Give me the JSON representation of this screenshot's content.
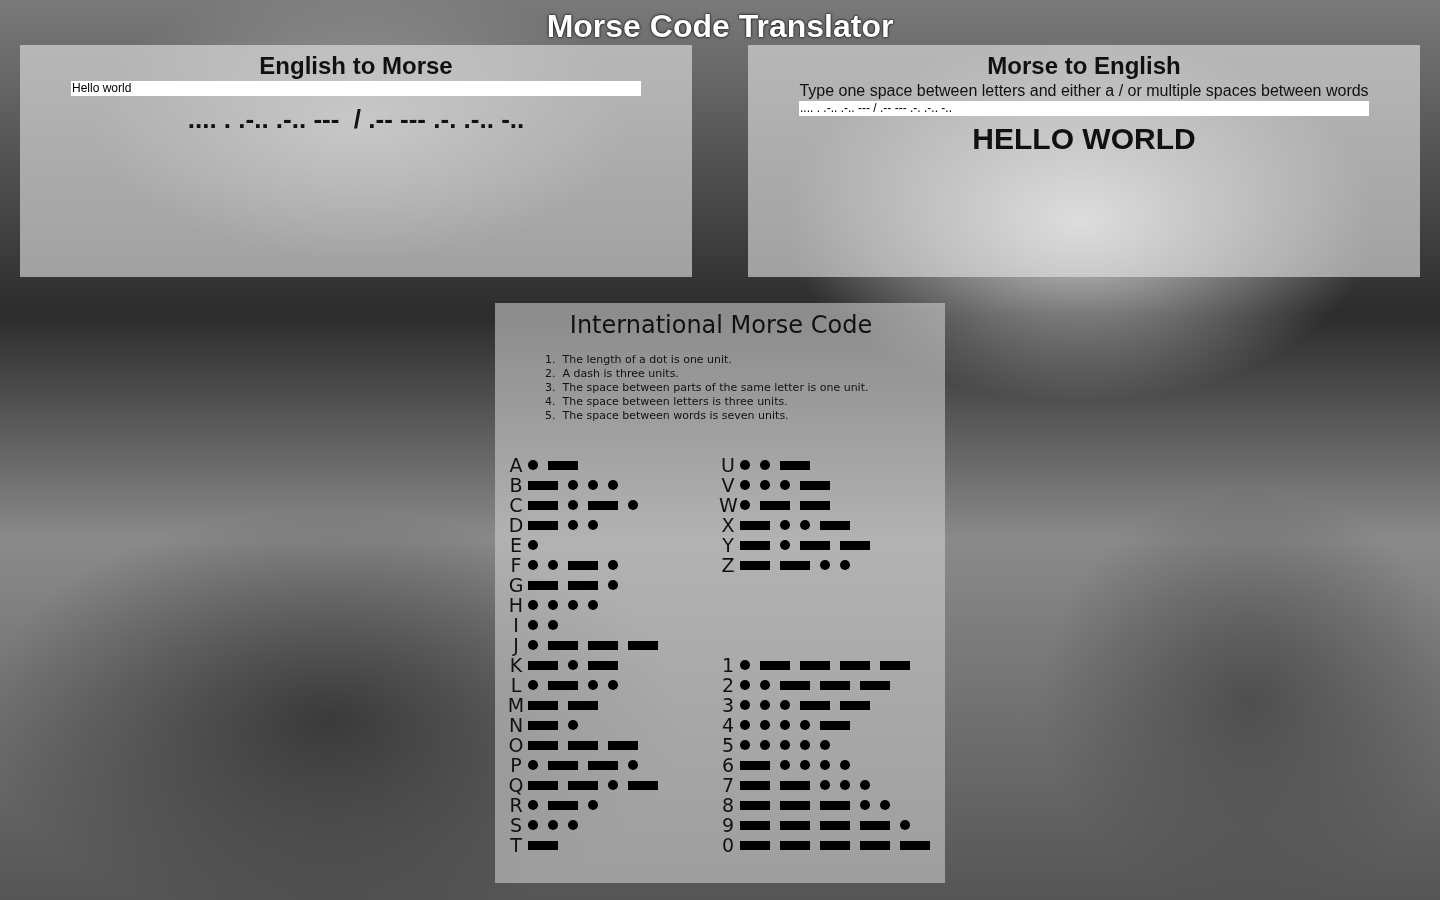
{
  "title": "Morse Code Translator",
  "english_to_morse": {
    "title": "English to Morse",
    "input": "Hello world",
    "output": ".... . .-.. .-.. ---  / .-- --- .-. .-.. -.."
  },
  "morse_to_english": {
    "title": "Morse to English",
    "hint": "Type one space between letters and either a / or multiple spaces between words",
    "input": ".... . .-.. .-.. --- / .-- --- .-. .-.. -..",
    "output": "HELLO WORLD"
  },
  "reference": {
    "title": "International Morse Code",
    "rules": [
      {
        "number": "1.",
        "text": "The length of a dot is one unit."
      },
      {
        "number": "2.",
        "text": "A dash is three units."
      },
      {
        "number": "3.",
        "text": "The space between parts of the same letter is one unit."
      },
      {
        "number": "4.",
        "text": "The space between letters is three units."
      },
      {
        "number": "5.",
        "text": "The space between words is seven units."
      }
    ],
    "letters": [
      {
        "char": "A",
        "code": ".-"
      },
      {
        "char": "B",
        "code": "-..."
      },
      {
        "char": "C",
        "code": "-.-."
      },
      {
        "char": "D",
        "code": "-.."
      },
      {
        "char": "E",
        "code": "."
      },
      {
        "char": "F",
        "code": "..-."
      },
      {
        "char": "G",
        "code": "--."
      },
      {
        "char": "H",
        "code": "...."
      },
      {
        "char": "I",
        "code": ".."
      },
      {
        "char": "J",
        "code": ".---"
      },
      {
        "char": "K",
        "code": "-.-"
      },
      {
        "char": "L",
        "code": ".-.."
      },
      {
        "char": "M",
        "code": "--"
      },
      {
        "char": "N",
        "code": "-."
      },
      {
        "char": "O",
        "code": "---"
      },
      {
        "char": "P",
        "code": ".--."
      },
      {
        "char": "Q",
        "code": "--.-"
      },
      {
        "char": "R",
        "code": ".-."
      },
      {
        "char": "S",
        "code": "..."
      },
      {
        "char": "T",
        "code": "-"
      },
      {
        "char": "U",
        "code": "..-"
      },
      {
        "char": "V",
        "code": "...-"
      },
      {
        "char": "W",
        "code": ".--"
      },
      {
        "char": "X",
        "code": "-..-"
      },
      {
        "char": "Y",
        "code": "-.--"
      },
      {
        "char": "Z",
        "code": "--.."
      }
    ],
    "digits": [
      {
        "char": "1",
        "code": ".----"
      },
      {
        "char": "2",
        "code": "..---"
      },
      {
        "char": "3",
        "code": "...--"
      },
      {
        "char": "4",
        "code": "....-"
      },
      {
        "char": "5",
        "code": "....."
      },
      {
        "char": "6",
        "code": "-...."
      },
      {
        "char": "7",
        "code": "--..."
      },
      {
        "char": "8",
        "code": "---.."
      },
      {
        "char": "9",
        "code": "----."
      },
      {
        "char": "0",
        "code": "-----"
      }
    ]
  }
}
